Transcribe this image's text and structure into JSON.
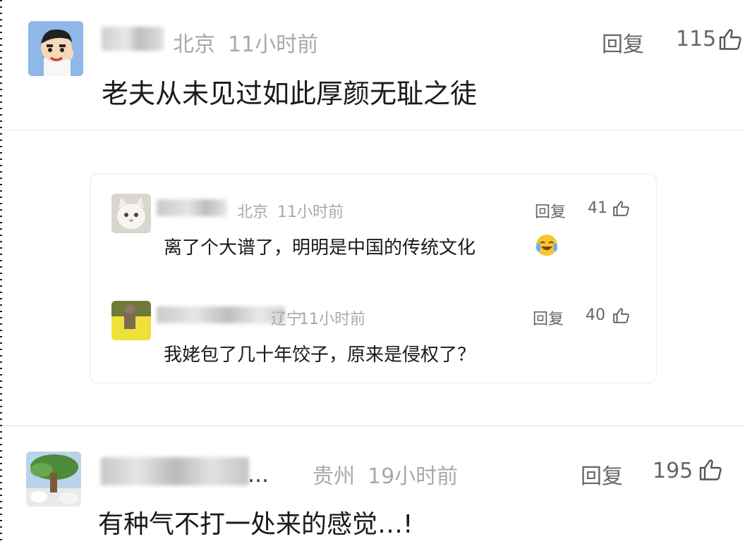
{
  "comments": [
    {
      "location": "北京",
      "time": "11小时前",
      "reply_label": "回复",
      "likes": "115",
      "text": "老夫从未见过如此厚颜无耻之徒",
      "avatar_icon": "cartoon-boy-avatar-icon"
    },
    {
      "location": "贵州",
      "time": "19小时前",
      "reply_label": "回复",
      "likes": "195",
      "text": "有种气不打一处来的感觉…!",
      "name_suffix": "…",
      "avatar_icon": "tree-landscape-avatar-icon"
    }
  ],
  "replies": [
    {
      "location": "北京",
      "time": "11小时前",
      "reply_label": "回复",
      "likes": "41",
      "text": "离了个大谱了，明明是中国的传统文化",
      "emoji_icon": "laughing-crying-emoji-icon",
      "avatar_icon": "white-cat-avatar-icon"
    },
    {
      "location": "辽宁",
      "time": "11小时前",
      "reply_label": "回复",
      "likes": "40",
      "text": "我姥包了几十年饺子，原来是侵权了？",
      "avatar_icon": "yellow-photo-avatar-icon"
    }
  ],
  "colors": {
    "meta_gray": "#a9a9a9",
    "text_dark": "#1a1a1a",
    "action_gray": "#666666",
    "card_bg": "#ffffff",
    "page_bg": "#f5f5f5"
  }
}
